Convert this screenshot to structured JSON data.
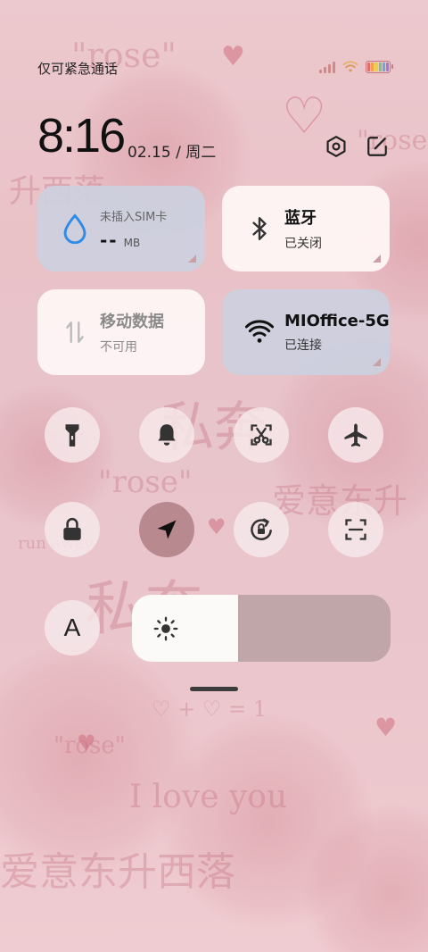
{
  "status_bar": {
    "carrier": "仅可紧急通话"
  },
  "clock": {
    "time": "8:16",
    "date": "02.15",
    "separator": "/",
    "weekday": "周二"
  },
  "tiles": {
    "sim": {
      "label": "未插入SIM卡",
      "value": "--",
      "unit": "MB",
      "icon": "water-drop-icon"
    },
    "bluetooth": {
      "label": "蓝牙",
      "status": "已关闭",
      "icon": "bluetooth-icon"
    },
    "mobile_data": {
      "label": "移动数据",
      "status": "不可用",
      "icon": "data-arrows-icon"
    },
    "wifi": {
      "label": "MIOffice-5G",
      "status": "已连接",
      "icon": "wifi-icon"
    }
  },
  "toggles": [
    {
      "name": "flashlight",
      "icon": "flashlight-icon",
      "active": false
    },
    {
      "name": "sound",
      "icon": "bell-icon",
      "active": false
    },
    {
      "name": "screenshot",
      "icon": "scissors-icon",
      "active": false
    },
    {
      "name": "airplane-mode",
      "icon": "airplane-icon",
      "active": false
    },
    {
      "name": "lock-screen",
      "icon": "lock-icon",
      "active": false
    },
    {
      "name": "location",
      "icon": "location-arrow-icon",
      "active": true
    },
    {
      "name": "rotation-lock",
      "icon": "rotation-lock-icon",
      "active": false
    },
    {
      "name": "scanner",
      "icon": "scan-icon",
      "active": false
    }
  ],
  "font_button": {
    "label": "A"
  },
  "brightness": {
    "level_percent": 41
  },
  "wallpaper": {
    "texts": [
      "\"rose\"",
      "\"rose\"",
      "\"rose\"",
      "\"rose\"",
      "升西落",
      "私奔",
      "私奔",
      "爱意东升",
      "I love you",
      "爱意东升西落",
      "♡ + ♡ = 1",
      "run away"
    ]
  },
  "colors": {
    "accent_active": "#b98990",
    "tile_grey": "#ccd0e0",
    "tile_white": "#fff6f6",
    "sim_icon": "#2f8be6"
  }
}
